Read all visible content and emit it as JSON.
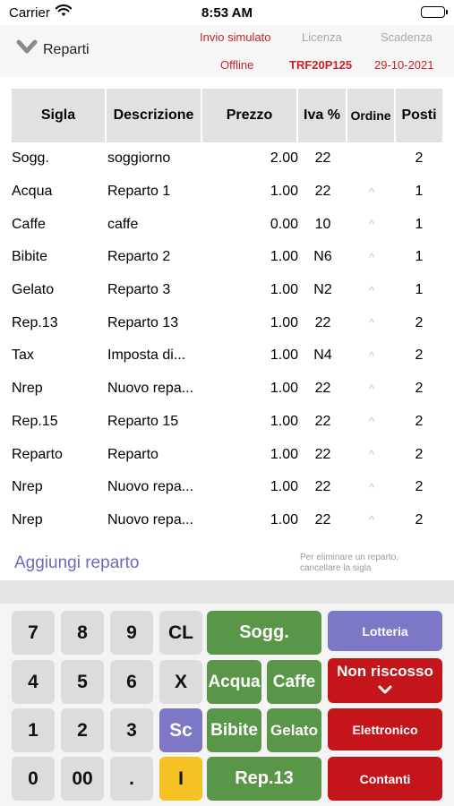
{
  "status": {
    "carrier": "Carrier",
    "time": "8:53 AM"
  },
  "nav": {
    "back_label": "Reparti",
    "invio": "Invio simulato",
    "licenza": "Licenza",
    "scadenza": "Scadenza",
    "offline": "Offline",
    "license_code": "TRF20P125",
    "expiry_date": "29-10-2021"
  },
  "table": {
    "headers": [
      "Sigla",
      "Descrizione",
      "Prezzo",
      "Iva %",
      "Ordine",
      "Posti"
    ],
    "rows": [
      {
        "sigla": "Sogg.",
        "descrizione": "soggiorno",
        "prezzo": "2.00",
        "iva": "22",
        "ordine": "",
        "posti": "2"
      },
      {
        "sigla": "Acqua",
        "descrizione": "Reparto 1",
        "prezzo": "1.00",
        "iva": "22",
        "ordine": "^",
        "posti": "1"
      },
      {
        "sigla": "Caffe",
        "descrizione": "caffe",
        "prezzo": "0.00",
        "iva": "10",
        "ordine": "^",
        "posti": "1"
      },
      {
        "sigla": "Bibite",
        "descrizione": "Reparto 2",
        "prezzo": "1.00",
        "iva": "N6",
        "ordine": "^",
        "posti": "1"
      },
      {
        "sigla": "Gelato",
        "descrizione": "Reparto 3",
        "prezzo": "1.00",
        "iva": "N2",
        "ordine": "^",
        "posti": "1"
      },
      {
        "sigla": "Rep.13",
        "descrizione": "Reparto 13",
        "prezzo": "1.00",
        "iva": "22",
        "ordine": "^",
        "posti": "2"
      },
      {
        "sigla": "Tax",
        "descrizione": "Imposta di...",
        "prezzo": "1.00",
        "iva": "N4",
        "ordine": "^",
        "posti": "2"
      },
      {
        "sigla": "Nrep",
        "descrizione": "Nuovo repa...",
        "prezzo": "1.00",
        "iva": "22",
        "ordine": "^",
        "posti": "2"
      },
      {
        "sigla": "Rep.15",
        "descrizione": "Reparto 15",
        "prezzo": "1.00",
        "iva": "22",
        "ordine": "^",
        "posti": "2"
      },
      {
        "sigla": "Reparto",
        "descrizione": "Reparto",
        "prezzo": "1.00",
        "iva": "22",
        "ordine": "^",
        "posti": "2"
      },
      {
        "sigla": "Nrep",
        "descrizione": "Nuovo repa...",
        "prezzo": "1.00",
        "iva": "22",
        "ordine": "^",
        "posti": "2"
      },
      {
        "sigla": "Nrep",
        "descrizione": "Nuovo repa...",
        "prezzo": "1.00",
        "iva": "22",
        "ordine": "^",
        "posti": "2"
      }
    ]
  },
  "footer": {
    "add_label": "Aggiungi reparto",
    "hint_line1": "Per eliminare un reparto,",
    "hint_line2": "cancellare la sigla"
  },
  "keypad": {
    "k7": "7",
    "k8": "8",
    "k9": "9",
    "kCL": "CL",
    "k4": "4",
    "k5": "5",
    "k6": "6",
    "kX": "X",
    "k1": "1",
    "k2": "2",
    "k3": "3",
    "kSc": "Sc",
    "k0": "0",
    "k00": "00",
    "kdot": ".",
    "kI": "I",
    "sogg": "Sogg.",
    "acqua": "Acqua",
    "caffe": "Caffe",
    "bibite": "Bibite",
    "gelato": "Gelato",
    "rep13": "Rep.13",
    "lotteria": "Lotteria",
    "non_riscosso": "Non riscosso",
    "elettronico": "Elettronico",
    "contanti": "Contanti"
  },
  "colors": {
    "green": "#5a9648",
    "purple": "#7d77c7",
    "red": "#c4151a",
    "yellow": "#f6c223",
    "link": "#6b6bbd",
    "accent_red": "#c8232c"
  }
}
